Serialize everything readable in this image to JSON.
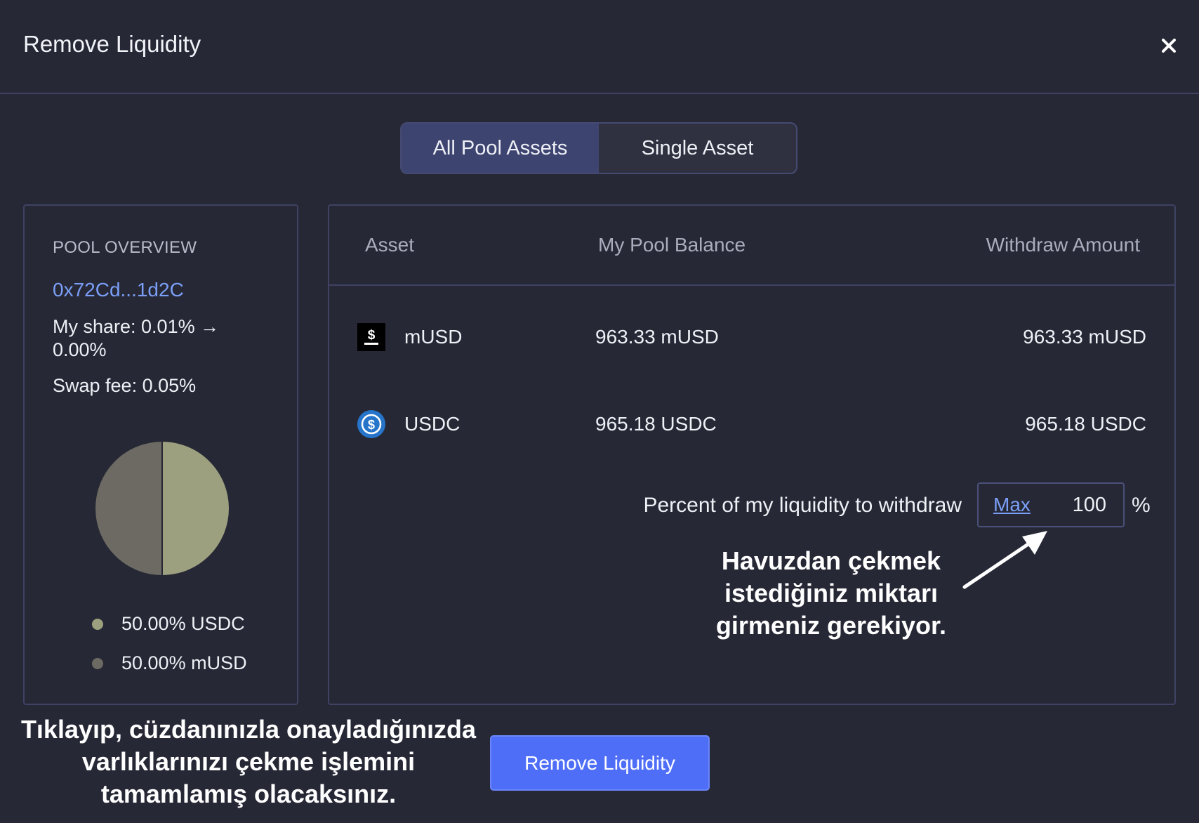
{
  "modal": {
    "title": "Remove Liquidity",
    "close_icon": "close-icon"
  },
  "tabs": [
    {
      "label": "All Pool Assets",
      "active": true
    },
    {
      "label": "Single Asset",
      "active": false
    }
  ],
  "overview": {
    "label": "POOL OVERVIEW",
    "address": "0x72Cd...1d2C",
    "share": "My share: 0.01% → 0.00%",
    "swap_fee": "Swap fee: 0.05%",
    "legend": [
      {
        "label": "50.00% USDC",
        "color": "#9da07e"
      },
      {
        "label": "50.00% mUSD",
        "color": "#6c6a62"
      }
    ]
  },
  "table": {
    "headers": {
      "asset": "Asset",
      "balance": "My Pool Balance",
      "withdraw": "Withdraw Amount"
    },
    "rows": [
      {
        "icon": "musd-icon",
        "asset": "mUSD",
        "balance": "963.33 mUSD",
        "withdraw": "963.33 mUSD"
      },
      {
        "icon": "usdc-icon",
        "asset": "USDC",
        "balance": "965.18 USDC",
        "withdraw": "965.18 USDC"
      }
    ]
  },
  "percent": {
    "label": "Percent of my liquidity to withdraw",
    "max_label": "Max",
    "value": "100",
    "unit": "%"
  },
  "annotations": {
    "input_hint": "Havuzdan çekmek istediğiniz miktarı girmeniz gerekiyor.",
    "button_hint": "Tıklayıp, cüzdanınızla onayladığınızda varlıklarınızı çekme işlemini tamamlamış olacaksınız."
  },
  "actions": {
    "remove_label": "Remove Liquidity"
  },
  "chart_data": {
    "type": "pie",
    "categories": [
      "USDC",
      "mUSD"
    ],
    "values": [
      50.0,
      50.0
    ],
    "colors": [
      "#9da07e",
      "#6c6a62"
    ]
  }
}
